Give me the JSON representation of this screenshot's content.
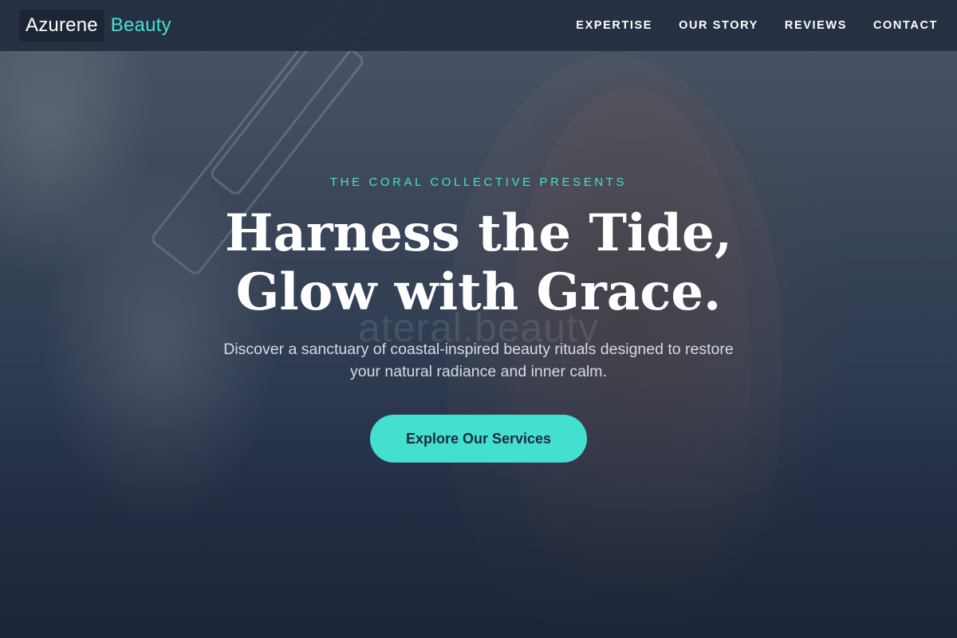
{
  "brand": {
    "name_primary": "Azurene",
    "name_accent": "Beauty",
    "accent_color": "#44e0cf",
    "header_background": "#242e40"
  },
  "nav": {
    "items": [
      {
        "label": "EXPERTISE"
      },
      {
        "label": "OUR STORY"
      },
      {
        "label": "REVIEWS"
      },
      {
        "label": "CONTACT"
      }
    ]
  },
  "hero": {
    "eyebrow": "THE CORAL COLLECTIVE PRESENTS",
    "headline_line1": "Harness the Tide,",
    "headline_line2": "Glow with Grace.",
    "watermark": "ateral.beauty",
    "subtitle": "Discover a sanctuary of coastal-inspired beauty rituals designed to restore your natural radiance and inner calm.",
    "cta_label": "Explore Our Services",
    "background_image": "woman-with-curling-iron-photo"
  }
}
